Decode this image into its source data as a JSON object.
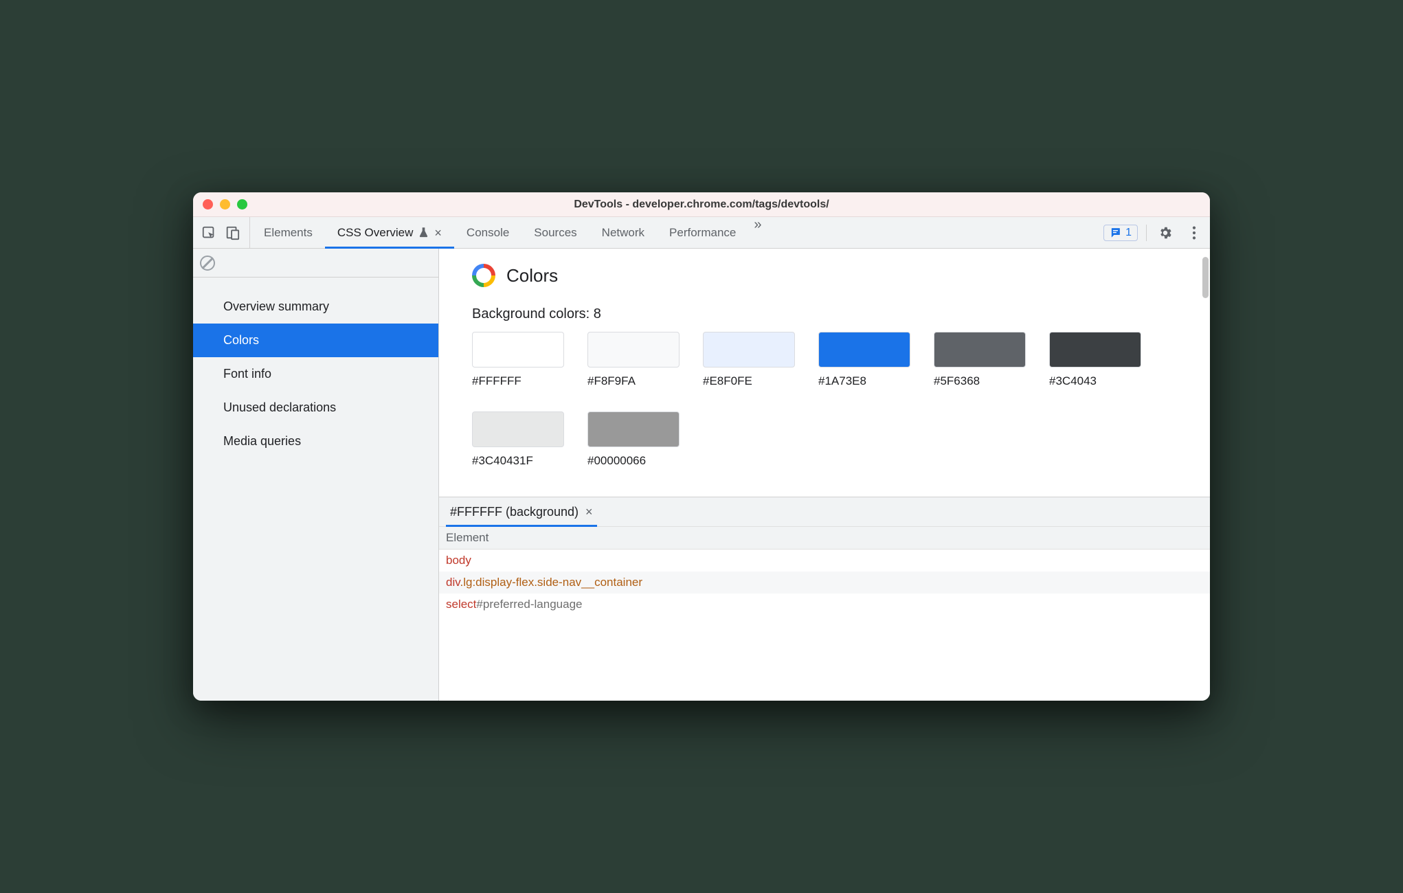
{
  "window": {
    "title": "DevTools - developer.chrome.com/tags/devtools/"
  },
  "toolbar": {
    "tabs": [
      {
        "label": "Elements"
      },
      {
        "label": "CSS Overview"
      },
      {
        "label": "Console"
      },
      {
        "label": "Sources"
      },
      {
        "label": "Network"
      },
      {
        "label": "Performance"
      }
    ],
    "active_tab_index": 1,
    "active_tab_experimental": true,
    "active_tab_closable": true,
    "issues_count": "1"
  },
  "sidebar": {
    "items": [
      {
        "label": "Overview summary"
      },
      {
        "label": "Colors"
      },
      {
        "label": "Font info"
      },
      {
        "label": "Unused declarations"
      },
      {
        "label": "Media queries"
      }
    ],
    "active_index": 1
  },
  "panel": {
    "title": "Colors",
    "subsection_label": "Background colors: 8",
    "swatches": [
      {
        "hex": "#FFFFFF",
        "display": "#FFFFFF"
      },
      {
        "hex": "#F8F9FA",
        "display": "#F8F9FA"
      },
      {
        "hex": "#E8F0FE",
        "display": "#E8F0FE"
      },
      {
        "hex": "#1A73E8",
        "display": "#1A73E8"
      },
      {
        "hex": "#5F6368",
        "display": "#5F6368"
      },
      {
        "hex": "#3C4043",
        "display": "#3C4043"
      },
      {
        "hex": "rgba(60,64,67,0.12)",
        "display": "#3C40431F"
      },
      {
        "hex": "rgba(0,0,0,0.4)",
        "display": "#00000066"
      }
    ]
  },
  "details": {
    "tab_label": "#FFFFFF (background)",
    "column_header": "Element",
    "rows": [
      {
        "tag": "body",
        "cls": "",
        "id": ""
      },
      {
        "tag": "div",
        "cls": ".lg:display-flex.side-nav__container",
        "id": ""
      },
      {
        "tag": "select",
        "cls": "",
        "id": "#preferred-language"
      }
    ]
  }
}
